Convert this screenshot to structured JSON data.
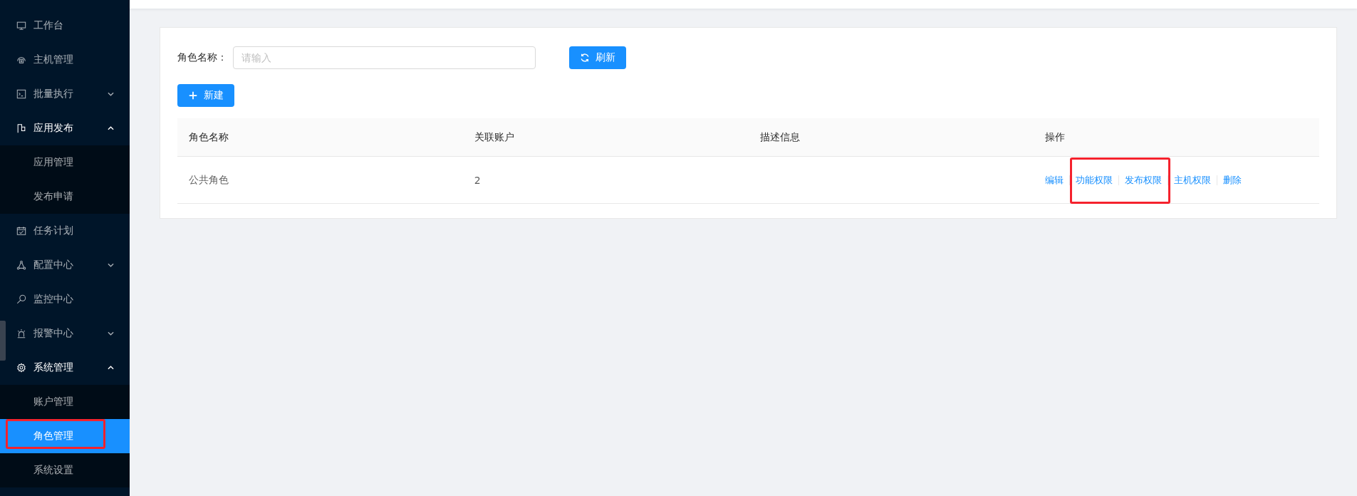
{
  "sidebar": {
    "items": [
      {
        "label": "工作台"
      },
      {
        "label": "主机管理"
      },
      {
        "label": "批量执行",
        "expanded": false
      },
      {
        "label": "应用发布",
        "expanded": true,
        "children": [
          {
            "label": "应用管理",
            "selected": false,
            "highlighted": false
          },
          {
            "label": "发布申请",
            "selected": false,
            "highlighted": false
          }
        ]
      },
      {
        "label": "任务计划"
      },
      {
        "label": "配置中心",
        "expanded": false
      },
      {
        "label": "监控中心"
      },
      {
        "label": "报警中心",
        "expanded": false
      },
      {
        "label": "系统管理",
        "expanded": true,
        "children": [
          {
            "label": "账户管理",
            "selected": false,
            "highlighted": false
          },
          {
            "label": "角色管理",
            "selected": true,
            "highlighted": true
          },
          {
            "label": "系统设置",
            "selected": false,
            "highlighted": false
          }
        ]
      }
    ]
  },
  "search": {
    "label": "角色名称：",
    "placeholder": "请输入",
    "refresh_button": "刷新"
  },
  "new_button": "新建",
  "table": {
    "columns": [
      "角色名称",
      "关联账户",
      "描述信息",
      "操作"
    ],
    "rows": [
      {
        "cells": [
          "公共角色",
          "2",
          ""
        ],
        "actions": [
          {
            "label": "编辑",
            "highlighted": false
          },
          {
            "label": "功能权限",
            "highlighted": true
          },
          {
            "label": "发布权限",
            "highlighted": true
          },
          {
            "label": "主机权限",
            "highlighted": false
          },
          {
            "label": "删除",
            "highlighted": false
          }
        ]
      }
    ]
  }
}
